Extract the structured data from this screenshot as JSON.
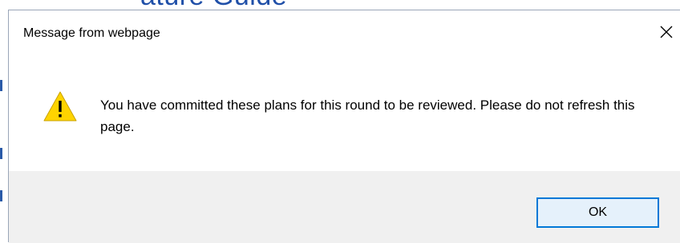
{
  "background_page": {
    "heading_fragment": "ature Guide"
  },
  "dialog": {
    "title": "Message from webpage",
    "close_icon": "close-icon",
    "warning_icon": "warning-icon",
    "warning_icon_color": "#ffd400",
    "message": "You have committed these plans for this round to be reviewed.  Please do not refresh this page.",
    "ok_label": "OK",
    "ok_border_color": "#0078d7",
    "footer_color": "#f0f0f0"
  }
}
